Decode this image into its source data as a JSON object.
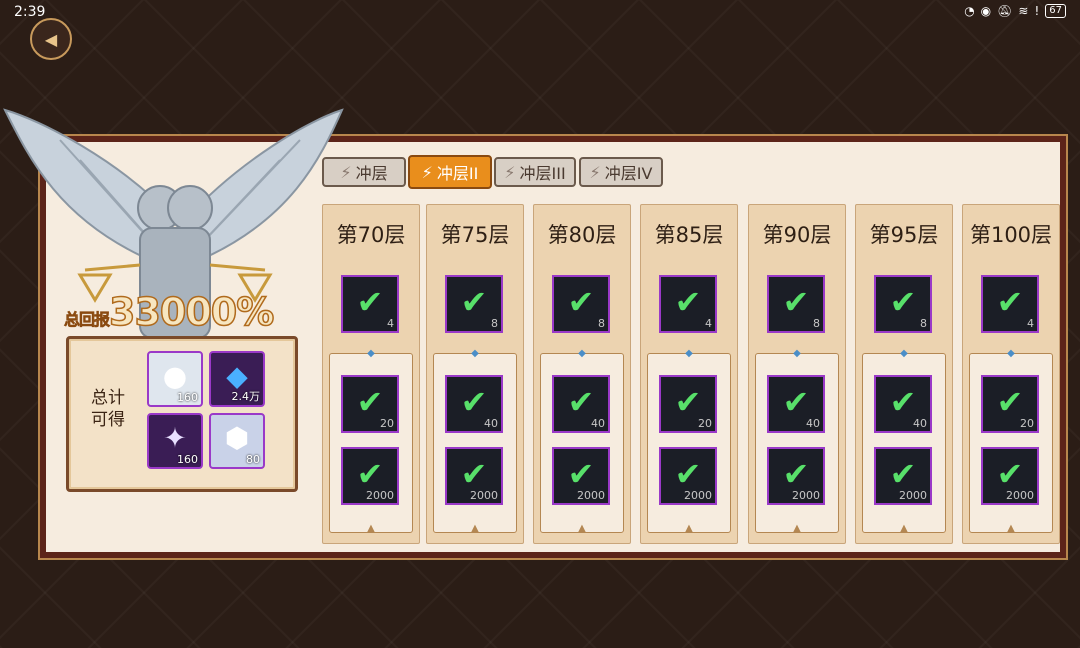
{
  "status": {
    "time": "2:39",
    "battery": "67"
  },
  "total": {
    "prefix": "总回报",
    "value": "33000%"
  },
  "rewards": {
    "label_line1": "总计",
    "label_line2": "可得",
    "items": [
      {
        "icon": "pearl-orb",
        "qty": "160"
      },
      {
        "icon": "blue-crystal",
        "qty": "2.4万"
      },
      {
        "icon": "star-shard",
        "qty": "160"
      },
      {
        "icon": "diamond-gem",
        "qty": "80"
      }
    ]
  },
  "tabs": [
    {
      "label": "冲层",
      "active": false
    },
    {
      "label": "冲层II",
      "active": true
    },
    {
      "label": "冲层III",
      "active": false
    },
    {
      "label": "冲层IV",
      "active": false
    }
  ],
  "columns": [
    {
      "title": "第70层",
      "top_qty": "4",
      "mid_qty": "20",
      "bottom_qty": "2000"
    },
    {
      "title": "第75层",
      "top_qty": "8",
      "mid_qty": "40",
      "bottom_qty": "2000"
    },
    {
      "title": "第80层",
      "top_qty": "8",
      "mid_qty": "40",
      "bottom_qty": "2000"
    },
    {
      "title": "第85层",
      "top_qty": "4",
      "mid_qty": "20",
      "bottom_qty": "2000"
    },
    {
      "title": "第90层",
      "top_qty": "8",
      "mid_qty": "40",
      "bottom_qty": "2000"
    },
    {
      "title": "第95层",
      "top_qty": "8",
      "mid_qty": "40",
      "bottom_qty": "2000"
    },
    {
      "title": "第100层",
      "top_qty": "4",
      "mid_qty": "20",
      "bottom_qty": "2000"
    }
  ],
  "colors": {
    "accent": "#e98e1c",
    "check": "#58e06a",
    "frame": "#5c2419",
    "item_border": "#9a39c8"
  }
}
